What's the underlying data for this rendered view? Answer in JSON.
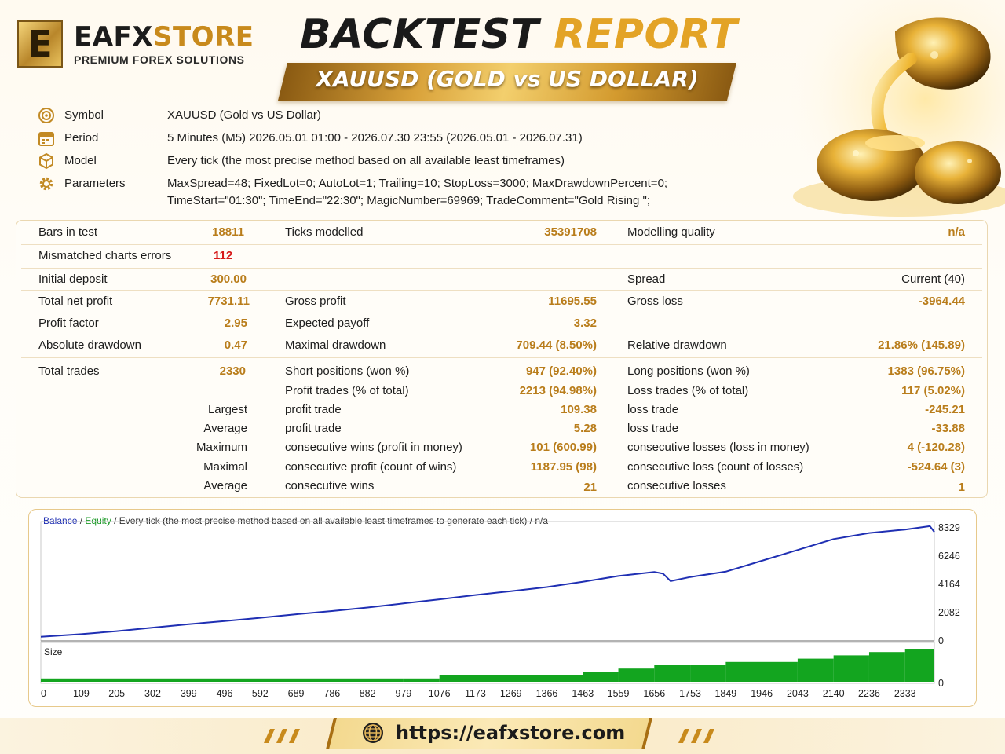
{
  "brand": {
    "logo_letter": "E",
    "name_part1": "EAFX",
    "name_part2": "STORE",
    "tagline": "PREMIUM FOREX SOLUTIONS"
  },
  "title": {
    "part1": "BACKTEST",
    "part2": "REPORT",
    "subtitle": "XAUUSD (GOLD vs US DOLLAR)"
  },
  "params": [
    {
      "icon": "target-icon",
      "key": "Symbol",
      "value": "XAUUSD (Gold vs US Dollar)"
    },
    {
      "icon": "calendar-icon",
      "key": "Period",
      "value": "5 Minutes (M5) 2026.05.01 01:00 - 2026.07.30 23:55 (2026.05.01 - 2026.07.31)"
    },
    {
      "icon": "cube-icon",
      "key": "Model",
      "value": "Every tick (the most precise method based on all available least timeframes)"
    },
    {
      "icon": "gear-icon",
      "key": "Parameters",
      "value": "MaxSpread=48; FixedLot=0; AutoLot=1; Trailing=10; StopLoss=3000; MaxDrawdownPercent=0;",
      "value2": "TimeStart=\"01:30\"; TimeEnd=\"22:30\"; MagicNumber=69969; TradeComment=\"Gold Rising \";"
    }
  ],
  "stats": {
    "bars_label": "Bars in test",
    "bars": "18811",
    "ticks_label": "Ticks modelled",
    "ticks": "35391708",
    "quality_label": "Modelling quality",
    "quality": "n/a",
    "mismatch_label": "Mismatched charts errors",
    "mismatch": "112",
    "deposit_label": "Initial deposit",
    "deposit": "300.00",
    "spread_label": "Spread",
    "spread": "Current (40)",
    "netprofit_label": "Total net profit",
    "netprofit": "7731.11",
    "grossprofit_label": "Gross profit",
    "grossprofit": "11695.55",
    "grossloss_label": "Gross loss",
    "grossloss": "-3964.44",
    "pf_label": "Profit factor",
    "pf": "2.95",
    "payoff_label": "Expected payoff",
    "payoff": "3.32",
    "absdd_label": "Absolute drawdown",
    "absdd": "0.47",
    "maxdd_label": "Maximal drawdown",
    "maxdd": "709.44 (8.50%)",
    "reldd_label": "Relative drawdown",
    "reldd": "21.86% (145.89)",
    "trades_label": "Total trades",
    "trades": "2330",
    "short_label": "Short positions (won %)",
    "short": "947 (92.40%)",
    "long_label": "Long positions (won %)",
    "long": "1383 (96.75%)",
    "profittrades_label": "Profit trades (% of total)",
    "profittrades": "2213 (94.98%)",
    "losstrades_label": "Loss trades (% of total)",
    "losstrades": "117 (5.02%)",
    "largest_label": "Largest",
    "largest_profit_label": "profit trade",
    "largest_profit": "109.38",
    "largest_loss_label": "loss trade",
    "largest_loss": "-245.21",
    "average_label": "Average",
    "avg_profit_label": "profit trade",
    "avg_profit": "5.28",
    "avg_loss_label": "loss trade",
    "avg_loss": "-33.88",
    "maximum_label": "Maximum",
    "max_wins_label": "consecutive wins (profit in money)",
    "max_wins": "101 (600.99)",
    "max_losses_label": "consecutive losses (loss in money)",
    "max_losses": "4 (-120.28)",
    "maximal_label": "Maximal",
    "maximal_profit_label": "consecutive profit (count of wins)",
    "maximal_profit": "1187.95 (98)",
    "maximal_loss_label": "consecutive loss (count of losses)",
    "maximal_loss": "-524.64 (3)",
    "average2_label": "Average",
    "avg_wins_label": "consecutive wins",
    "avg_wins": "21",
    "avg_losses_label": "consecutive losses",
    "avg_losses": "1"
  },
  "chart_legend": {
    "balance": "Balance",
    "sep1": " / ",
    "equity": "Equity",
    "rest": " / Every tick (the most precise method based on all available least timeframes to generate each tick) / n/a"
  },
  "chart_data": {
    "type": "line",
    "series": [
      {
        "name": "Balance",
        "color": "#1f2fb3",
        "x": [
          0,
          109,
          205,
          302,
          399,
          496,
          592,
          689,
          786,
          882,
          979,
          1076,
          1173,
          1269,
          1366,
          1463,
          1559,
          1656,
          1680,
          1700,
          1753,
          1849,
          1946,
          2043,
          2140,
          2236,
          2333,
          2400,
          2412
        ],
        "y": [
          300,
          500,
          720,
          980,
          1230,
          1460,
          1700,
          1960,
          2200,
          2460,
          2760,
          3060,
          3380,
          3660,
          3960,
          4350,
          4780,
          5080,
          4950,
          4400,
          4700,
          5100,
          5900,
          6700,
          7500,
          7950,
          8200,
          8450,
          8030
        ]
      }
    ],
    "size_panel": {
      "label": "Size",
      "y_tick": "0",
      "x": [
        0,
        979,
        1076,
        1463,
        1559,
        1656,
        1753,
        1849,
        1946,
        2043,
        2140,
        2236,
        2333,
        2412
      ],
      "values": [
        1,
        1,
        2,
        3,
        4,
        5,
        5,
        6,
        6,
        7,
        8,
        9,
        10,
        10
      ]
    },
    "x_ticks": [
      "0",
      "109",
      "205",
      "302",
      "399",
      "496",
      "592",
      "689",
      "786",
      "882",
      "979",
      "1076",
      "1173",
      "1269",
      "1366",
      "1463",
      "1559",
      "1656",
      "1753",
      "1849",
      "1946",
      "2043",
      "2140",
      "2236",
      "2333"
    ],
    "y_ticks": [
      "8329",
      "6246",
      "4164",
      "2082",
      "0"
    ],
    "ylim": [
      0,
      8329
    ],
    "xlim": [
      0,
      2412
    ]
  },
  "footer": {
    "url": "https://eafxstore.com",
    "icon": "globe-icon"
  }
}
